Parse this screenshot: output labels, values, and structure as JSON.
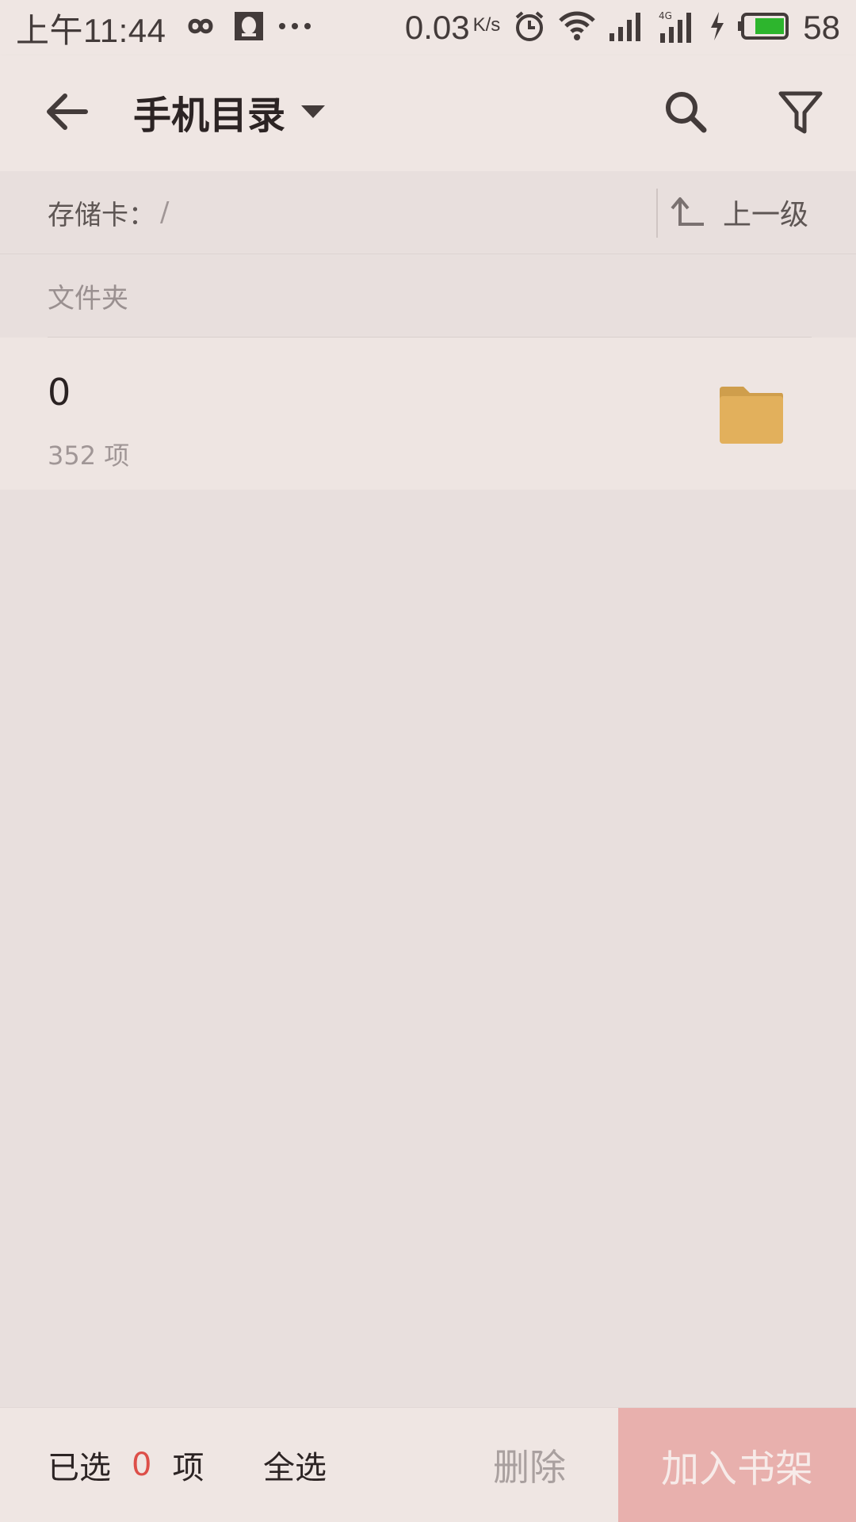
{
  "status_bar": {
    "time": "上午11:44",
    "net_speed": "0.03",
    "net_speed_unit": "K/s",
    "battery_percent": "58",
    "icons": [
      "infinity-icon",
      "qq-icon",
      "more-dots-icon",
      "alarm-icon",
      "wifi-icon",
      "signal-icon",
      "signal-4g-icon",
      "charging-icon",
      "battery-icon"
    ],
    "battery_color": "#2db52d"
  },
  "app_bar": {
    "title": "手机目录",
    "back_icon": "arrow-left-icon",
    "dropdown_icon": "caret-down-icon",
    "search_icon": "search-icon",
    "filter_icon": "filter-icon"
  },
  "path_bar": {
    "label": "存储卡：",
    "path": "/",
    "up_label": "上一级",
    "up_icon": "level-up-icon"
  },
  "section": {
    "header": "文件夹"
  },
  "folders": [
    {
      "name": "0",
      "meta": "352 项",
      "icon": "folder-icon",
      "icon_color": "#e2b05c"
    }
  ],
  "bottom_bar": {
    "selected_prefix": "已选",
    "selected_count": "0",
    "selected_suffix": "项",
    "select_all": "全选",
    "delete": "删除",
    "add_to_shelf": "加入书架",
    "accent_color": "#e8b0ad",
    "count_color": "#dd4f49"
  }
}
